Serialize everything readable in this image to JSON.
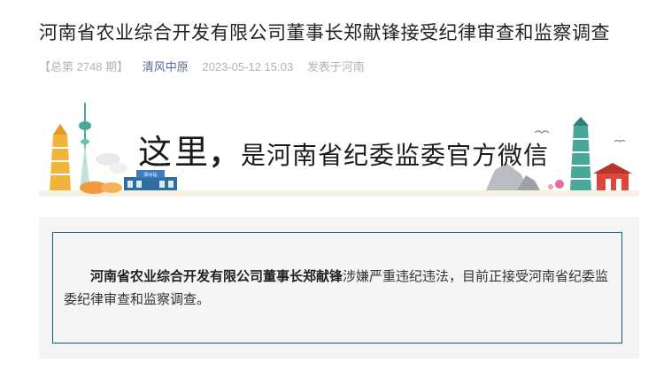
{
  "article": {
    "title": "河南省农业综合开发有限公司董事长郑献锋接受纪律审查和监察调查",
    "issue": "【总第 2748 期】",
    "account": "清风中原",
    "datetime": "2023-05-12 15:03",
    "location": "发表于河南"
  },
  "banner": {
    "here": "这里",
    "comma": "，",
    "rest": "是河南省纪委监委官方微信",
    "sign_text": "郑州站"
  },
  "content": {
    "bold_part": "河南省农业综合开发有限公司董事长郑献锋",
    "body_part": "涉嫌严重违纪违法，目前正接受河南省纪委监委纪律审查和监察调查。"
  },
  "colors": {
    "account_link": "#576b95",
    "meta_gray": "#b2b2b2",
    "card_border": "#0f5e78",
    "card_bg": "#f4f4f4",
    "tower_gold": "#f2b33d",
    "tower_teal": "#4aa89a"
  }
}
